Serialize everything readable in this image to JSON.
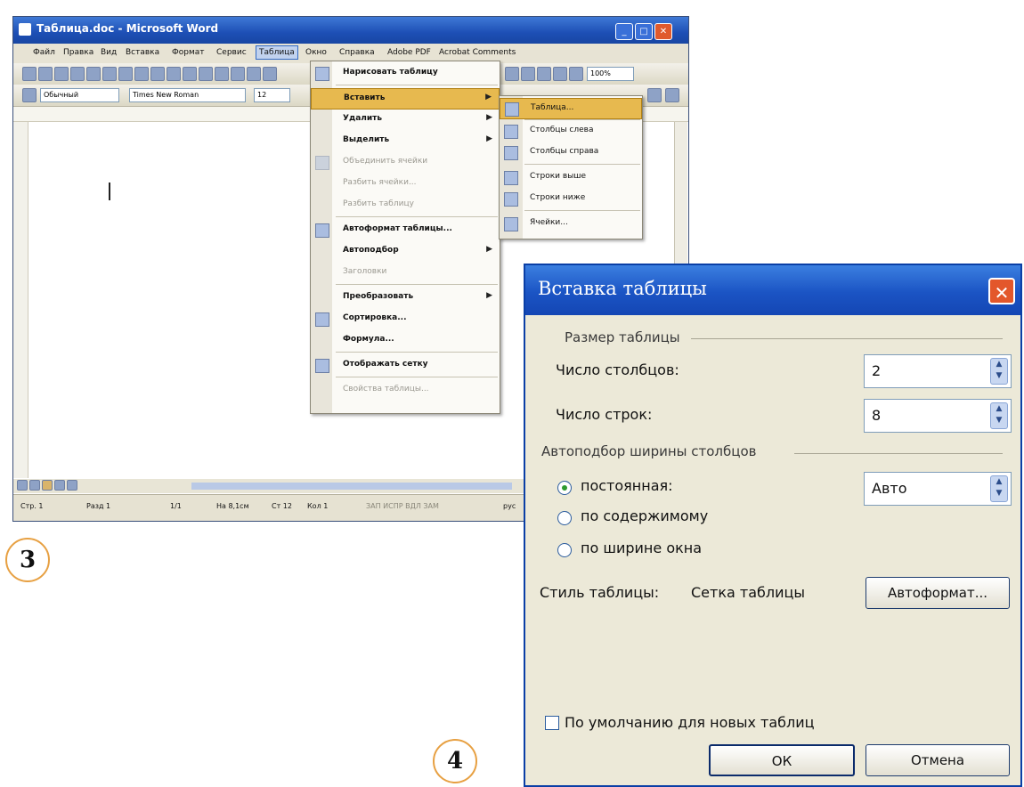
{
  "word_window": {
    "title": "Таблица.doc - Microsoft Word",
    "menu": [
      "Файл",
      "Правка",
      "Вид",
      "Вставка",
      "Формат",
      "Сервис",
      "Таблица",
      "Окно",
      "Справка",
      "Adobe PDF",
      "Acrobat Comments"
    ],
    "style_combo": "Обычный",
    "font_combo": "Times New Roman",
    "size_combo": "12",
    "zoom_combo": "100%",
    "status": {
      "page": "Стр. 1",
      "section": "Разд 1",
      "pages": "1/1",
      "at": "На 8,1см",
      "line": "Ст 12",
      "col": "Кол 1",
      "modes": "ЗАП  ИСПР  ВДЛ  ЗАМ",
      "lang": "рус"
    }
  },
  "table_menu": {
    "items": [
      {
        "label": "Нарисовать таблицу",
        "enabled": true,
        "submenu": false,
        "icon": "pencil-icon"
      },
      {
        "label": "Вставить",
        "enabled": true,
        "submenu": true,
        "highlighted": true
      },
      {
        "label": "Удалить",
        "enabled": true,
        "submenu": true
      },
      {
        "label": "Выделить",
        "enabled": true,
        "submenu": true
      },
      {
        "label": "Объединить ячейки",
        "enabled": false,
        "submenu": false,
        "icon": "merge-cells-icon"
      },
      {
        "label": "Разбить ячейки...",
        "enabled": false,
        "submenu": false
      },
      {
        "label": "Разбить таблицу",
        "enabled": false,
        "submenu": false
      },
      {
        "label": "Автоформат таблицы...",
        "enabled": true,
        "submenu": false,
        "icon": "autoformat-icon"
      },
      {
        "label": "Автоподбор",
        "enabled": true,
        "submenu": true
      },
      {
        "label": "Заголовки",
        "enabled": false,
        "submenu": false
      },
      {
        "label": "Преобразовать",
        "enabled": true,
        "submenu": true
      },
      {
        "label": "Сортировка...",
        "enabled": true,
        "submenu": false,
        "icon": "sort-icon"
      },
      {
        "label": "Формула...",
        "enabled": true,
        "submenu": false
      },
      {
        "label": "Отображать сетку",
        "enabled": true,
        "submenu": false,
        "icon": "grid-icon"
      },
      {
        "label": "Свойства таблицы...",
        "enabled": false,
        "submenu": false
      }
    ]
  },
  "insert_submenu": {
    "items": [
      {
        "label": "Таблица...",
        "highlighted": true,
        "icon": "table-icon"
      },
      {
        "label": "Столбцы слева",
        "icon": "columns-left-icon"
      },
      {
        "label": "Столбцы справа",
        "icon": "columns-right-icon"
      },
      {
        "label": "Строки выше",
        "icon": "rows-above-icon"
      },
      {
        "label": "Строки ниже",
        "icon": "rows-below-icon"
      },
      {
        "label": "Ячейки...",
        "icon": "cells-icon"
      }
    ]
  },
  "badges": {
    "step3": "3",
    "step4": "4"
  },
  "dialog": {
    "title": "Вставка таблицы",
    "size_group": "Размер таблицы",
    "columns_label": "Число столбцов:",
    "columns_value": "2",
    "rows_label": "Число строк:",
    "rows_value": "8",
    "autofit_group": "Автоподбор ширины столбцов",
    "radio_fixed": "постоянная:",
    "fixed_value": "Авто",
    "radio_content": "по содержимому",
    "radio_window": "по ширине окна",
    "style_label": "Стиль таблицы:",
    "style_value": "Сетка таблицы",
    "autoformat_button": "Автоформат...",
    "default_checkbox": "По умолчанию для новых таблиц",
    "ok_button": "ОК",
    "cancel_button": "Отмена",
    "selected_radio": "fixed"
  }
}
